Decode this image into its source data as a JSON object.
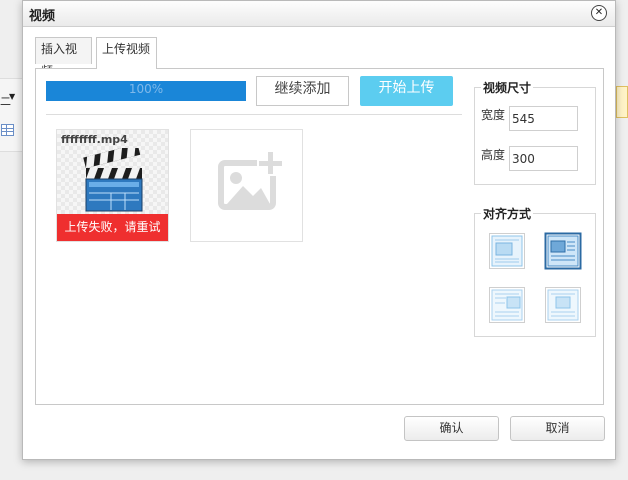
{
  "background": {
    "menu_text": "二"
  },
  "dialog": {
    "title": "视频",
    "tabs": [
      {
        "label": "插入视频",
        "active": false
      },
      {
        "label": "上传视频",
        "active": true
      }
    ],
    "upload": {
      "progress_percent": 100,
      "progress_label": "100%",
      "continue_label": "继续添加",
      "start_label": "开始上传",
      "files": [
        {
          "name": "ffffffff.mp4",
          "status": "上传失败，请重试",
          "icon": "video-clapperboard-icon",
          "status_color": "#ef2f2f"
        }
      ],
      "add_icon": "add-image-icon"
    },
    "video_size": {
      "title": "视频尺寸",
      "width_label": "宽度",
      "width_value": "545",
      "height_label": "高度",
      "height_value": "300"
    },
    "alignment": {
      "title": "对齐方式",
      "options": [
        {
          "name": "none",
          "selected": false
        },
        {
          "name": "left",
          "selected": true
        },
        {
          "name": "right",
          "selected": false
        },
        {
          "name": "center",
          "selected": false
        }
      ]
    },
    "footer": {
      "confirm_label": "确认",
      "cancel_label": "取消"
    }
  },
  "colors": {
    "progress": "#1a86d8",
    "start_button": "#5ccdf0",
    "fail": "#ef2f2f"
  }
}
